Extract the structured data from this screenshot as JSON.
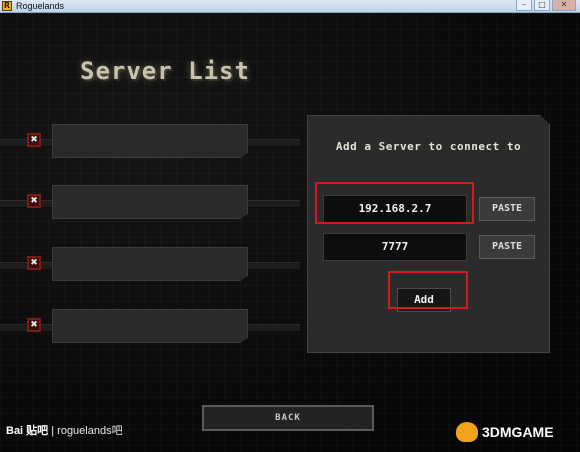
{
  "window": {
    "title": "Roguelands",
    "icon_letter": "R",
    "controls": [
      "–",
      "□",
      "✕"
    ]
  },
  "page": {
    "title": "Server List"
  },
  "server_slots": [
    {
      "delete_glyph": "✖",
      "name": ""
    },
    {
      "delete_glyph": "✖",
      "name": ""
    },
    {
      "delete_glyph": "✖",
      "name": ""
    },
    {
      "delete_glyph": "✖",
      "name": ""
    }
  ],
  "add_panel": {
    "heading": "Add a Server to connect to",
    "ip_value": "192.168.2.7",
    "port_value": "7777",
    "paste_label": "PASTE",
    "add_label": "Add"
  },
  "back_label": "BACK",
  "watermarks": {
    "left_logo": "Bai 贴吧",
    "left_text": "| roguelands吧",
    "right_text": "3DMGAME"
  },
  "colors": {
    "highlight_frame": "#d61a1a",
    "background": "#0b0b0b",
    "panel": "#2b2b2b"
  }
}
